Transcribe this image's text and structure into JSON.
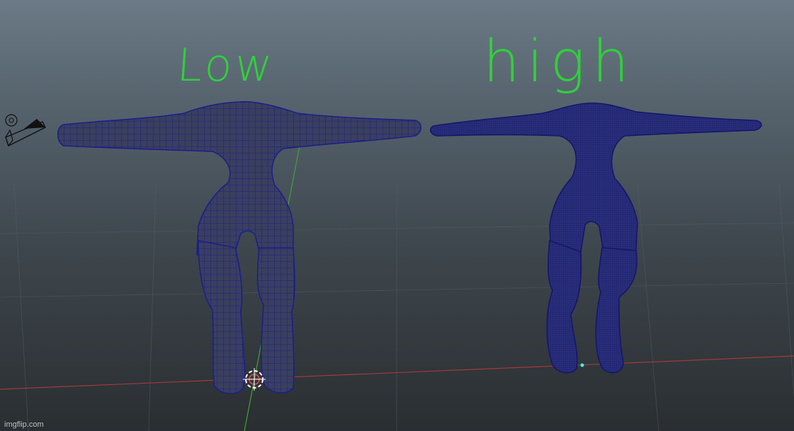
{
  "scene": {
    "labels": {
      "low": "Low",
      "high": "high"
    },
    "watermark": "imgflip.com"
  },
  "colors": {
    "background_top": "#6b7a86",
    "background_bottom": "#2a2e31",
    "mesh_wire": "#1c1f8a",
    "mesh_fill": "#2a2f7a",
    "label_green": "#2fd13a",
    "axis_x_red": "#a23a3a",
    "axis_y_green": "#3fa33a",
    "grid": "#55606a"
  },
  "icons": [
    "camera-icon",
    "pivot-manipulator-icon",
    "vertex-dot-icon"
  ]
}
